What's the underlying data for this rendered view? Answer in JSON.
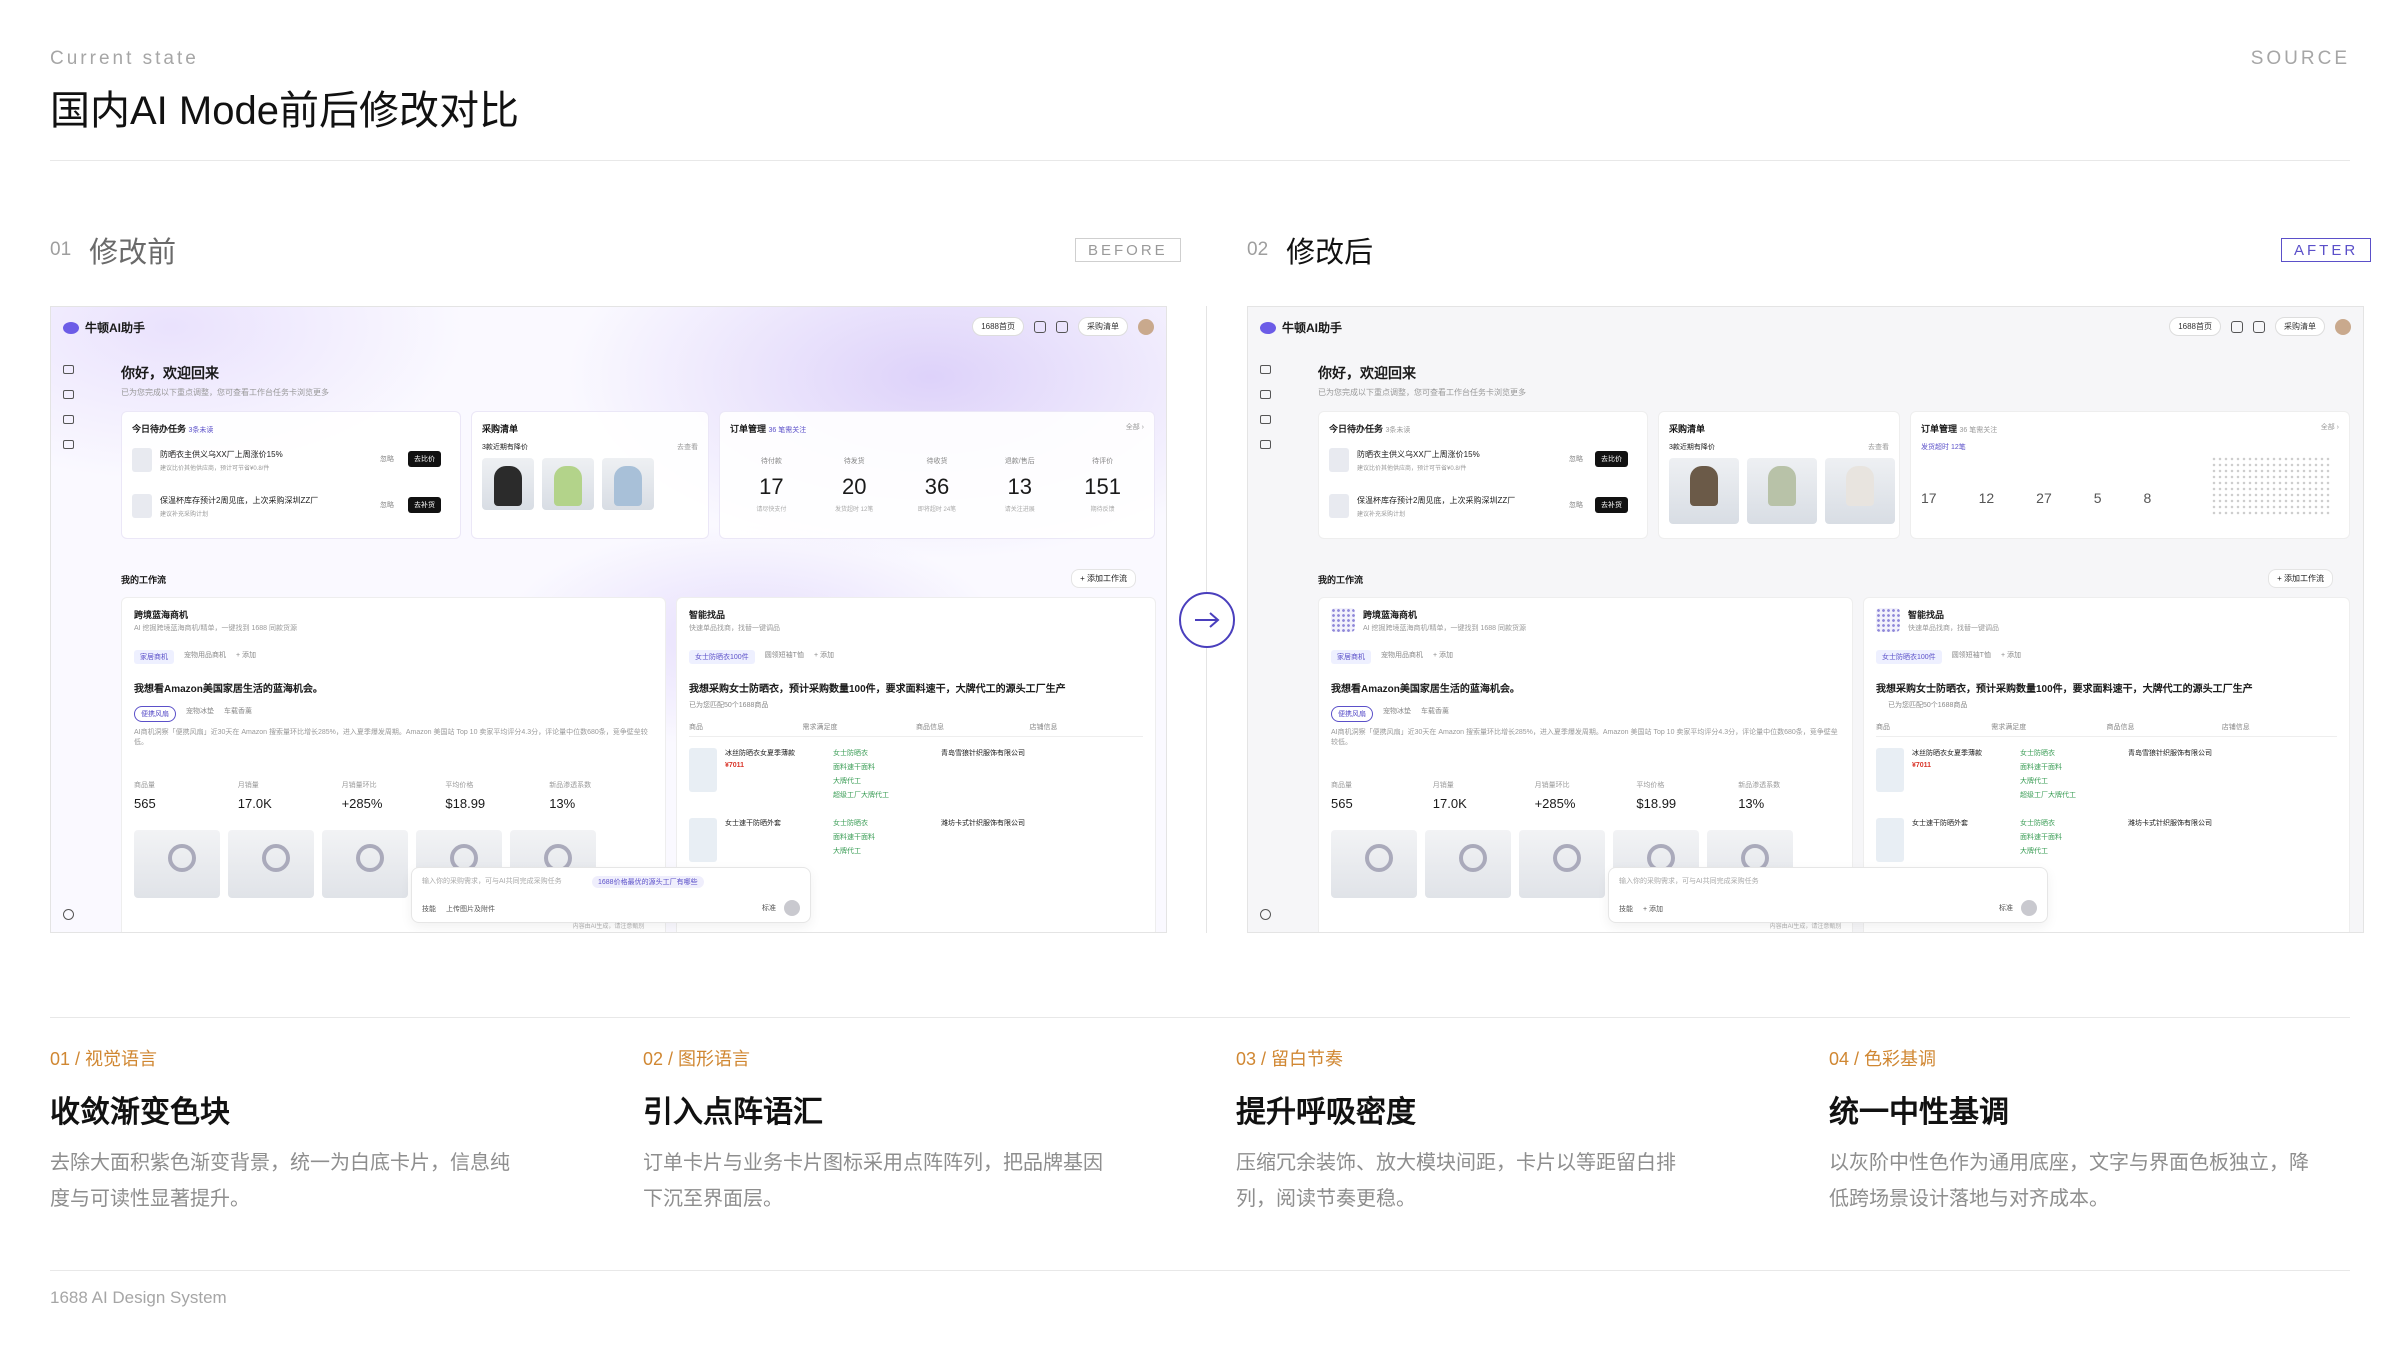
{
  "header": {
    "eyebrow": "Current state",
    "source": "SOURCE",
    "title": "国内AI Mode前后修改对比"
  },
  "before": {
    "num": "01",
    "title": "修改前",
    "tag": "BEFORE"
  },
  "after": {
    "num": "02",
    "title": "修改后",
    "tag": "AFTER"
  },
  "mock": {
    "app_name": "牛顿AI助手",
    "home": "1688首页",
    "purchase": "采购清单",
    "greeting": "你好，欢迎回来",
    "greeting_sub": "已为您完成以下重点调整，您可查看工作台任务卡浏览更多",
    "todo_title": "今日待办任务",
    "todo_count": "3条未读",
    "task1": "防晒衣主供义乌XX厂上周涨价15%",
    "task1_btn": "去比价",
    "task1_sub": "建议比价其他供应商，预计可节省¥0.8/件",
    "task2": "保温杯库存预计2周见底，上次采购深圳ZZ厂",
    "task2_btn": "去补货",
    "task2_sub": "建议补充采购计划",
    "task_ignore": "忽略",
    "cart_title": "采购清单",
    "cart_sub": "3款近期有降价",
    "cart_more": "去查看",
    "order_title": "订单管理",
    "order_badge": "36 笔需关注",
    "order_all": "全部 ›",
    "stats": [
      {
        "label": "待付款",
        "value": "17",
        "sub": "请尽快支付"
      },
      {
        "label": "待发货",
        "value": "20",
        "sub": "发货超时 12笔"
      },
      {
        "label": "待收货",
        "value": "36",
        "sub": "即将超时 24笔"
      },
      {
        "label": "退款/售后",
        "value": "13",
        "sub": "请关注进展"
      },
      {
        "label": "待评价",
        "value": "151",
        "sub": "期待反馈"
      }
    ],
    "after_stats": [
      "17",
      "12",
      "27",
      "5",
      "8"
    ],
    "workflow": "我的工作流",
    "add_workflow": "+ 添加工作流",
    "wf1_title": "跨境蓝海商机",
    "wf1_sub": "AI 挖掘跨境蓝海商机/精单，一键找到 1688 同款货源",
    "wf1_tab1": "家居商机",
    "wf1_tab2": "宠物用品商机",
    "wf1_add": "+ 添加",
    "wf1_query": "我想看Amazon美国家居生活的蓝海机会。",
    "wf1_chip1": "便携风扇",
    "wf1_chip2": "宠物冰垫",
    "wf1_chip3": "车载香薰",
    "wf1_text": "AI商机洞察「便携风扇」近30天在 Amazon 搜索量环比增长285%，进入夏季爆发周期。Amazon 美国站 Top 10 卖家平均评分4.3分，评论量中位数680条，竞争壁垒较低。",
    "kpis": [
      {
        "label": "商品量",
        "value": "565"
      },
      {
        "label": "月销量",
        "value": "17.0K"
      },
      {
        "label": "月销量环比",
        "value": "+285%"
      },
      {
        "label": "平均价格",
        "value": "$18.99"
      },
      {
        "label": "新品渗透系数",
        "value": "13%"
      }
    ],
    "wf2_title": "智能找品",
    "wf2_sub": "快速单品找商，找替一键调品",
    "wf2_tab1": "女士防晒衣100件",
    "wf2_tab2": "圆领短袖T恤",
    "wf2_query": "我想采购女士防晒衣，预计采购数量100件，要求面料速干，大牌代工的源头工厂生产",
    "wf2_note": "已为您匹配50个1688商品",
    "tbl_head": [
      "商品",
      "需求满足度",
      "商品信息",
      "店铺信息"
    ],
    "p1_name": "冰丝防晒衣女夏季薄款",
    "p1_price": "¥7011",
    "p1_checks": [
      "女士防晒衣",
      "面料速干面料",
      "大牌代工",
      "超级工厂大牌代工"
    ],
    "p1_shop": "青岛雪狼针织服饰有限公司",
    "p2_name": "女士速干防晒外套",
    "p2_checks": [
      "女士防晒衣",
      "面料速干面料",
      "大牌代工"
    ],
    "p2_shop": "潍坊卡式针织服饰有限公司",
    "input_ph": "输入你的采购需求，可与AI共同完成采购任务",
    "input_chip": "1688价格最优的源头工厂有哪些",
    "input_skill": "技能",
    "input_upload": "上传图片及附件",
    "input_std": "标准",
    "footer": "内容由AI生成，请注意甄别"
  },
  "points": [
    {
      "tag": "01 / 视觉语言",
      "title": "收敛渐变色块",
      "desc": "去除大面积紫色渐变背景，统一为白底卡片，信息纯度与可读性显著提升。"
    },
    {
      "tag": "02 / 图形语言",
      "title": "引入点阵语汇",
      "desc": "订单卡片与业务卡片图标采用点阵阵列，把品牌基因下沉至界面层。"
    },
    {
      "tag": "03 / 留白节奏",
      "title": "提升呼吸密度",
      "desc": "压缩冗余装饰、放大模块间距，卡片以等距留白排列，阅读节奏更稳。"
    },
    {
      "tag": "04 / 色彩基调",
      "title": "统一中性基调",
      "desc": "以灰阶中性色作为通用底座，文字与界面色板独立，降低跨场景设计落地与对齐成本。"
    }
  ],
  "brand": "1688 AI Design System",
  "colors": {
    "accent": "#5b50c9",
    "tag_orange": "#d08732",
    "price_red": "#d9362b"
  }
}
